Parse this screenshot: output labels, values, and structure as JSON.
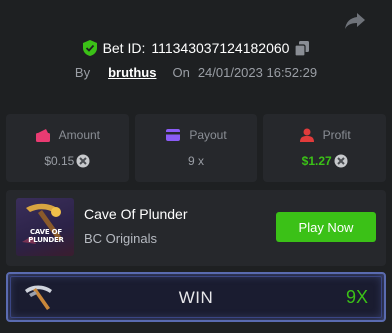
{
  "header": {
    "bet_id_label": "Bet ID:",
    "bet_id": "111343037124182060",
    "by_label": "By",
    "username": "bruthus",
    "on_label": "On",
    "datetime": "24/01/2023 16:52:29"
  },
  "stats": [
    {
      "label": "Amount",
      "value": "$0.15",
      "icon": "wallet-icon",
      "color": "#e93b72"
    },
    {
      "label": "Payout",
      "value": "9 x",
      "icon": "card-icon",
      "color": "#8b5cf6"
    },
    {
      "label": "Profit",
      "value": "$1.27",
      "icon": "profit-icon",
      "color": "#e23b3b"
    }
  ],
  "game": {
    "title": "Cave Of Plunder",
    "provider": "BC Originals",
    "thumb_text": "CAVE OF PLUNDER",
    "play_label": "Play Now"
  },
  "result": {
    "label": "WIN",
    "multiplier": "9X"
  },
  "colors": {
    "accent_green": "#3bc117",
    "background": "#1e2022",
    "card": "#26282c"
  }
}
